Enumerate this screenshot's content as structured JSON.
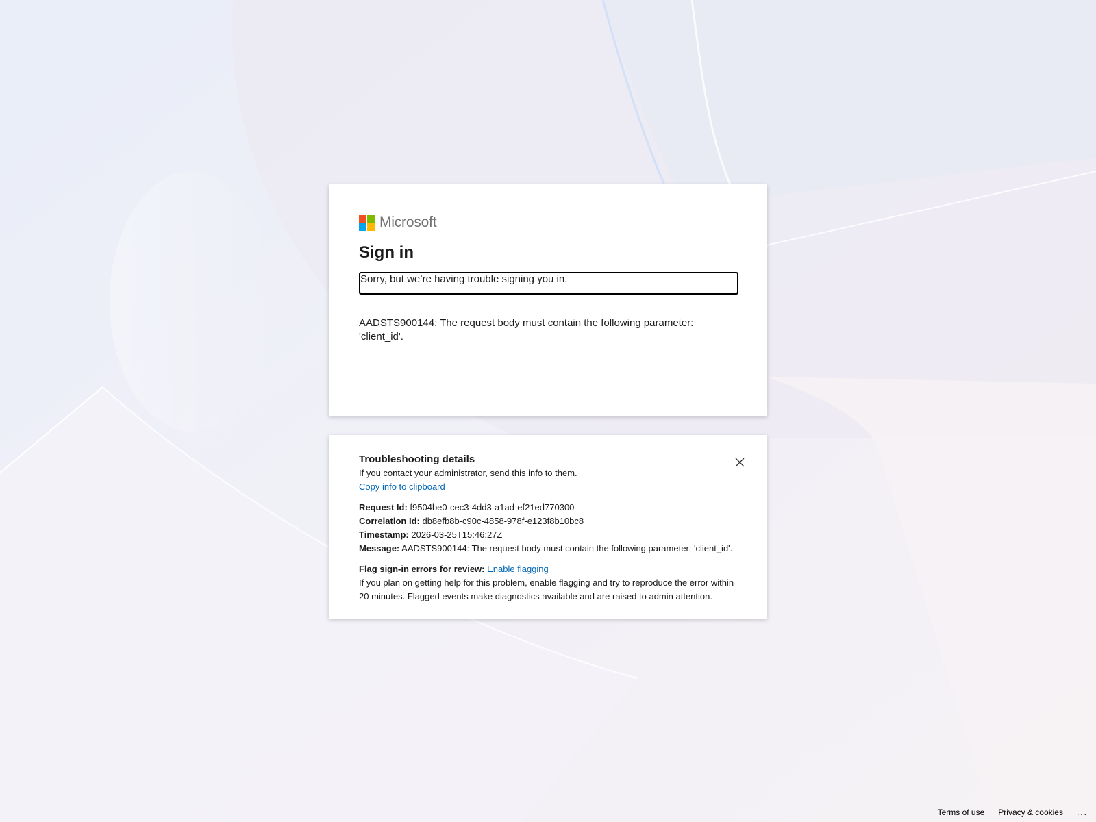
{
  "brand": {
    "name": "Microsoft",
    "colors": [
      "#f25022",
      "#7fba00",
      "#00a4ef",
      "#ffb900"
    ]
  },
  "main": {
    "title": "Sign in",
    "alert": "Sorry, but we’re having trouble signing you in.",
    "message": "AADSTS900144: The request body must contain the following parameter: 'client_id'."
  },
  "details": {
    "title": "Troubleshooting details",
    "intro": "If you contact your administrator, send this info to them.",
    "copy_link": "Copy info to clipboard",
    "request_id_label": "Request Id:",
    "request_id": "f9504be0-cec3-4dd3-a1ad-ef21ed770300",
    "correlation_id_label": "Correlation Id:",
    "correlation_id": "db8efb8b-c90c-4858-978f-e123f8b10bc8",
    "timestamp_label": "Timestamp:",
    "timestamp": "2026-03-25T15:46:27Z",
    "message_label": "Message:",
    "message": "AADSTS900144: The request body must contain the following parameter: 'client_id'.",
    "flag_label": "Flag sign-in errors for review:",
    "flag_link": "Enable flagging",
    "flag_text": "If you plan on getting help for this problem, enable flagging and try to reproduce the error within 20 minutes. Flagged events make diagnostics available and are raised to admin attention."
  },
  "footer": {
    "terms": "Terms of use",
    "privacy": "Privacy & cookies",
    "more": "..."
  }
}
